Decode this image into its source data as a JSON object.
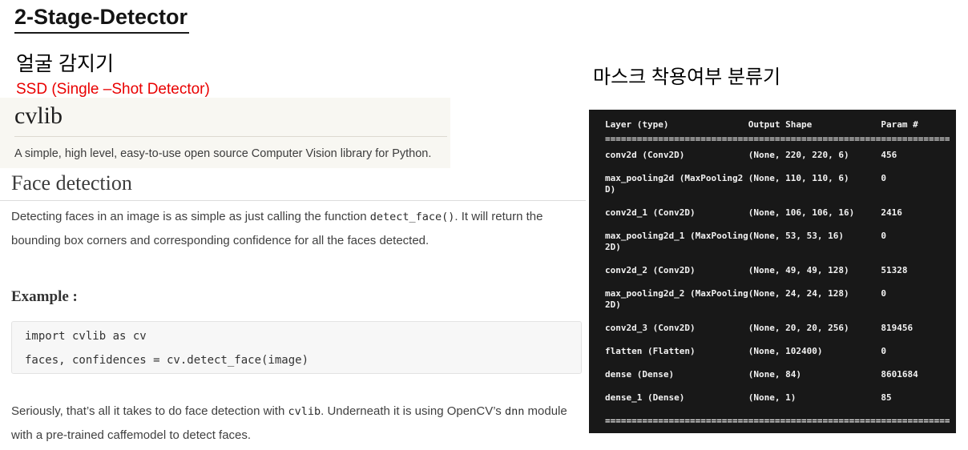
{
  "colors": {
    "accent_red": "#e90000",
    "terminal_bg": "#181818",
    "terminal_text": "#f2f2f2",
    "doc_header_bg": "#f8f7f2",
    "code_block_bg": "#f7f7f7"
  },
  "slide": {
    "title": "2-Stage-Detector"
  },
  "left": {
    "heading": "얼굴 감지기",
    "subheading": "SSD (Single –Shot Detector)",
    "cvlib": {
      "brand": "cvlib",
      "tagline": "A simple, high level, easy-to-use open source Computer Vision library for Python.",
      "section_heading": "Face detection",
      "para1_pre": "Detecting faces in an image is as simple as just calling the function ",
      "para1_code": "detect_face()",
      "para1_post": ". It will return the bounding box corners and corresponding confidence for all the faces detected.",
      "example_heading": "Example :",
      "code_line1": "import cvlib as cv",
      "code_line2": "faces, confidences = cv.detect_face(image)",
      "para2_pre": "Seriously, that’s all it takes to do face detection with ",
      "para2_code1": "cvlib",
      "para2_mid": ". Underneath it is using OpenCV’s ",
      "para2_code2": "dnn",
      "para2_post": " module with a pre-trained caffemodel to detect faces."
    }
  },
  "right": {
    "heading": "마스크 착용여부 분류기",
    "model_summary": {
      "col_layer": "Layer (type)",
      "col_shape": "Output Shape",
      "col_params": "Param #",
      "separator": "========================================================================",
      "rows": [
        {
          "layer": "conv2d (Conv2D)",
          "shape": "(None, 220, 220, 6)",
          "params": "456"
        },
        {
          "layer": "max_pooling2d (MaxPooling2D)",
          "shape": "(None, 110, 110, 6)",
          "params": "0"
        },
        {
          "layer": "conv2d_1 (Conv2D)",
          "shape": "(None, 106, 106, 16)",
          "params": "2416"
        },
        {
          "layer": "max_pooling2d_1 (MaxPooling2D)",
          "shape": "(None, 53, 53, 16)",
          "params": "0"
        },
        {
          "layer": "conv2d_2 (Conv2D)",
          "shape": "(None, 49, 49, 128)",
          "params": "51328"
        },
        {
          "layer": "max_pooling2d_2 (MaxPooling2D)",
          "shape": "(None, 24, 24, 128)",
          "params": "0"
        },
        {
          "layer": "conv2d_3 (Conv2D)",
          "shape": "(None, 20, 20, 256)",
          "params": "819456"
        },
        {
          "layer": "flatten (Flatten)",
          "shape": "(None, 102400)",
          "params": "0"
        },
        {
          "layer": "dense (Dense)",
          "shape": "(None, 84)",
          "params": "8601684"
        },
        {
          "layer": "dense_1 (Dense)",
          "shape": "(None, 1)",
          "params": "85"
        }
      ]
    }
  }
}
